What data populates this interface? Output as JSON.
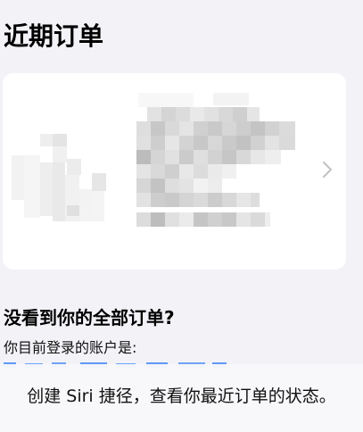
{
  "header": {
    "title": "近期订单"
  },
  "order_card": {
    "chevron_icon": "chevron-right-icon",
    "info_redacted": true
  },
  "help": {
    "title": "没看到你的全部订单?",
    "account_label": "你目前登录的账户是:"
  },
  "siri": {
    "message": "创建 Siri 捷径，查看你最近订单的状态。"
  },
  "colors": {
    "background": "#f2f2f7",
    "card": "#ffffff",
    "link": "#1a73e8"
  }
}
